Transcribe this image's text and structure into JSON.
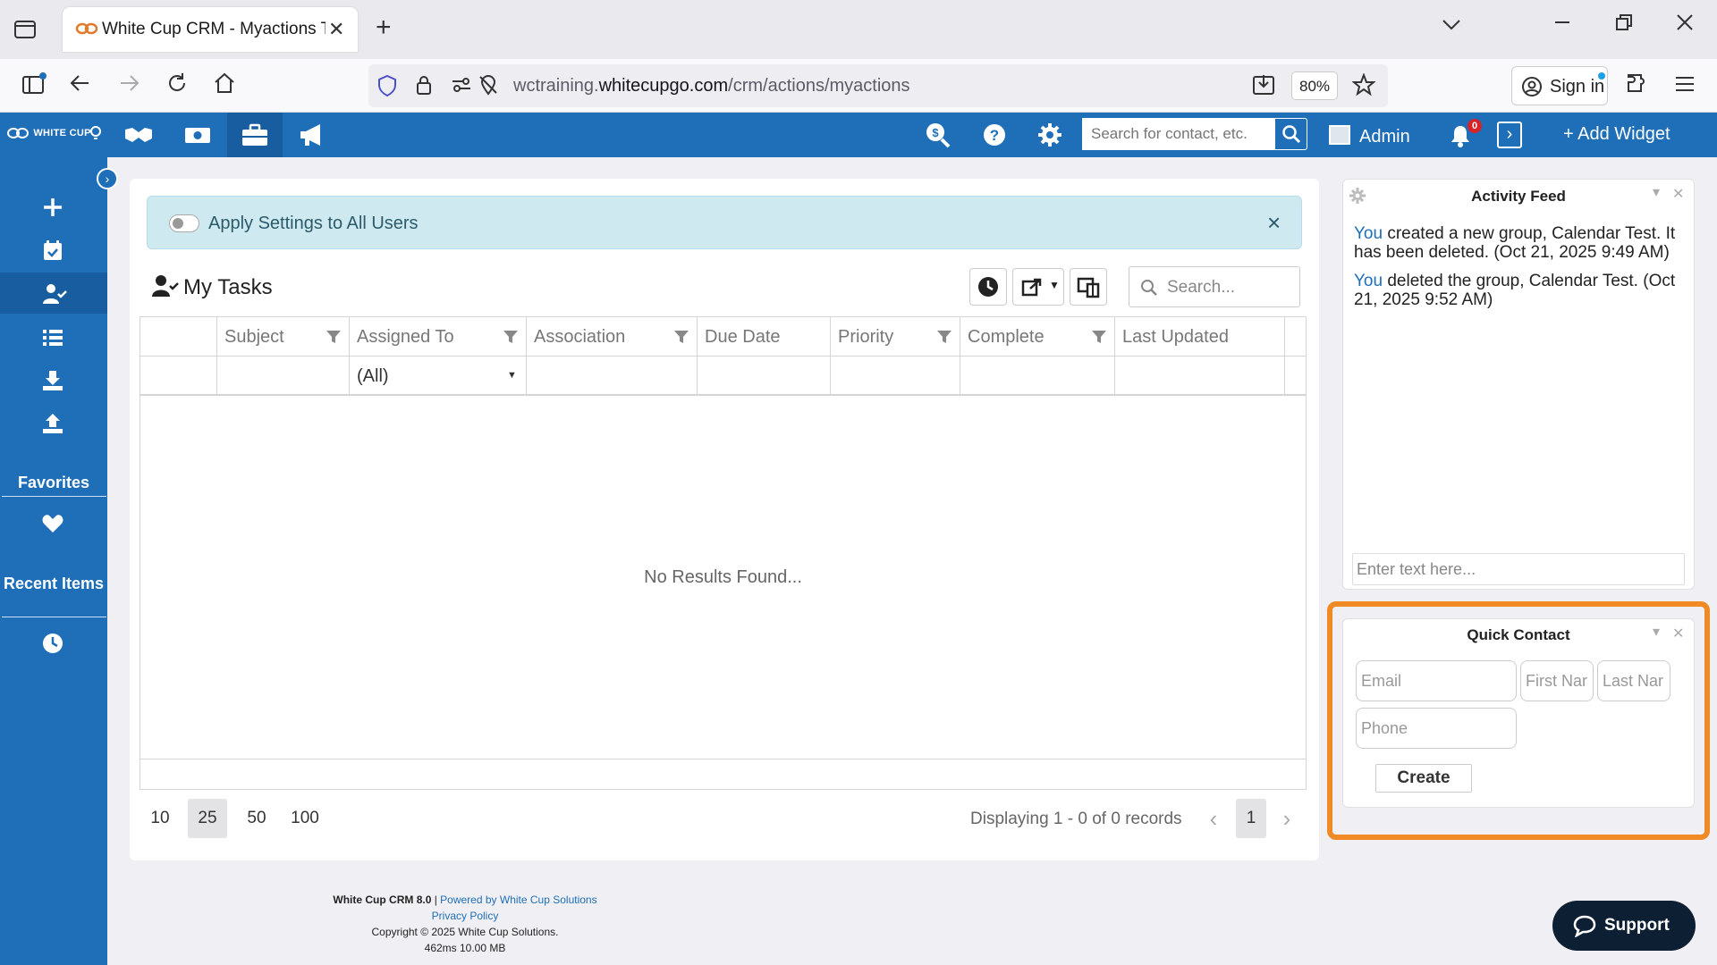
{
  "browser": {
    "tab_title": "White Cup CRM - Myactions Tas",
    "url_prefix": "wctraining.",
    "url_domain": "whitecupgo.com",
    "url_path": "/crm/actions/myactions",
    "zoom": "80%",
    "sign_in": "Sign in"
  },
  "header": {
    "brand": "WHITE CUP",
    "search_placeholder": "Search for contact, etc.",
    "user": "Admin",
    "notification_count": "0",
    "add_widget": "+ Add Widget"
  },
  "sidebar": {
    "favorites": "Favorites",
    "recent_items": "Recent Items"
  },
  "main": {
    "alert_text": "Apply Settings to All Users",
    "title": "My Tasks",
    "search_placeholder": "Search...",
    "columns": [
      "Subject",
      "Assigned To",
      "Association",
      "Due Date",
      "Priority",
      "Complete",
      "Last Updated"
    ],
    "assigned_filter": "(All)",
    "empty_text": "No Results Found...",
    "page_sizes": [
      "10",
      "25",
      "50",
      "100"
    ],
    "selected_page_size": "25",
    "displaying": "Displaying 1 - 0 of 0 records",
    "current_page": "1"
  },
  "activity_feed": {
    "title": "Activity Feed",
    "entries": [
      {
        "actor": "You",
        "text": " created a new group, Calendar Test. It has been deleted. (Oct 21, 2025 9:49 AM)"
      },
      {
        "actor": "You",
        "text": " deleted the group, Calendar Test. (Oct 21, 2025 9:52 AM)"
      }
    ],
    "input_placeholder": "Enter text here..."
  },
  "quick_contact": {
    "title": "Quick Contact",
    "email_placeholder": "Email",
    "first_name_placeholder": "First Nar",
    "last_name_placeholder": "Last Nar",
    "phone_placeholder": "Phone",
    "create_label": "Create"
  },
  "footer": {
    "product": "White Cup CRM 8.0",
    "separator": " | ",
    "powered_by": "Powered by White Cup Solutions",
    "privacy": "Privacy Policy",
    "copyright": "Copyright © 2025 White Cup Solutions.",
    "stats": "462ms 10.00 MB"
  },
  "support_label": "Support",
  "colors": {
    "brand_blue": "#1e6eb8",
    "highlight_orange": "#f08a24",
    "alert_bg": "#cfe9f1"
  }
}
